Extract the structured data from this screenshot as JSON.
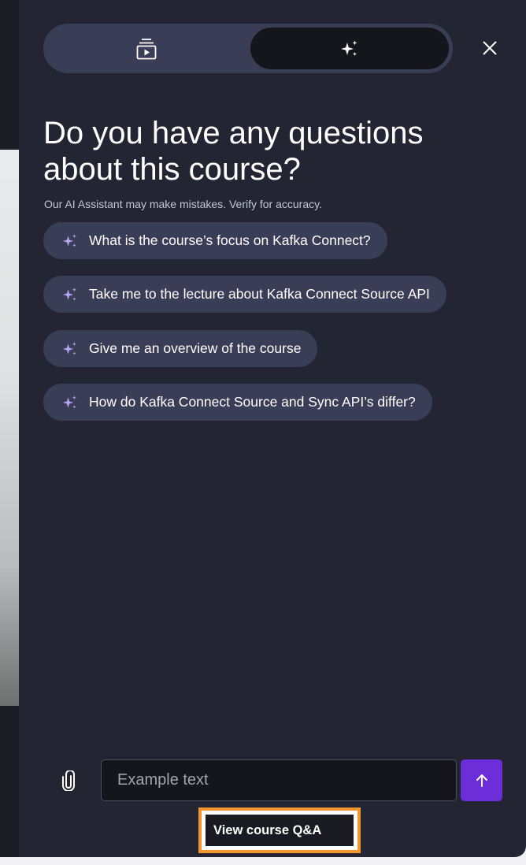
{
  "sidebar_toggle": {
    "left_icon": "course-content-icon",
    "right_icon": "ai-assistant-sparkle-icon"
  },
  "close_icon": "close-icon",
  "heading": "Do you have any questions about this course?",
  "disclaimer": "Our AI Assistant may make mistakes. Verify for accuracy.",
  "suggestions": [
    {
      "icon": "sparkle-icon",
      "label": "What is the course’s focus on Kafka Connect?"
    },
    {
      "icon": "sparkle-icon",
      "label": "Take me to the lecture about Kafka Connect Source API"
    },
    {
      "icon": "sparkle-icon",
      "label": "Give me an overview of the course"
    },
    {
      "icon": "sparkle-icon",
      "label": "How do Kafka Connect Source and Sync API’s differ?"
    }
  ],
  "composer": {
    "attach_icon": "paperclip-icon",
    "placeholder": "Example text",
    "send_icon": "arrow-up-icon"
  },
  "qa_link": "View course Q&A",
  "colors": {
    "panel_bg": "#232533",
    "chip_bg": "#3a3d56",
    "sparkle": "#b9a4f7",
    "send_bg": "#6c2ed9",
    "highlight": "#f1962e"
  }
}
